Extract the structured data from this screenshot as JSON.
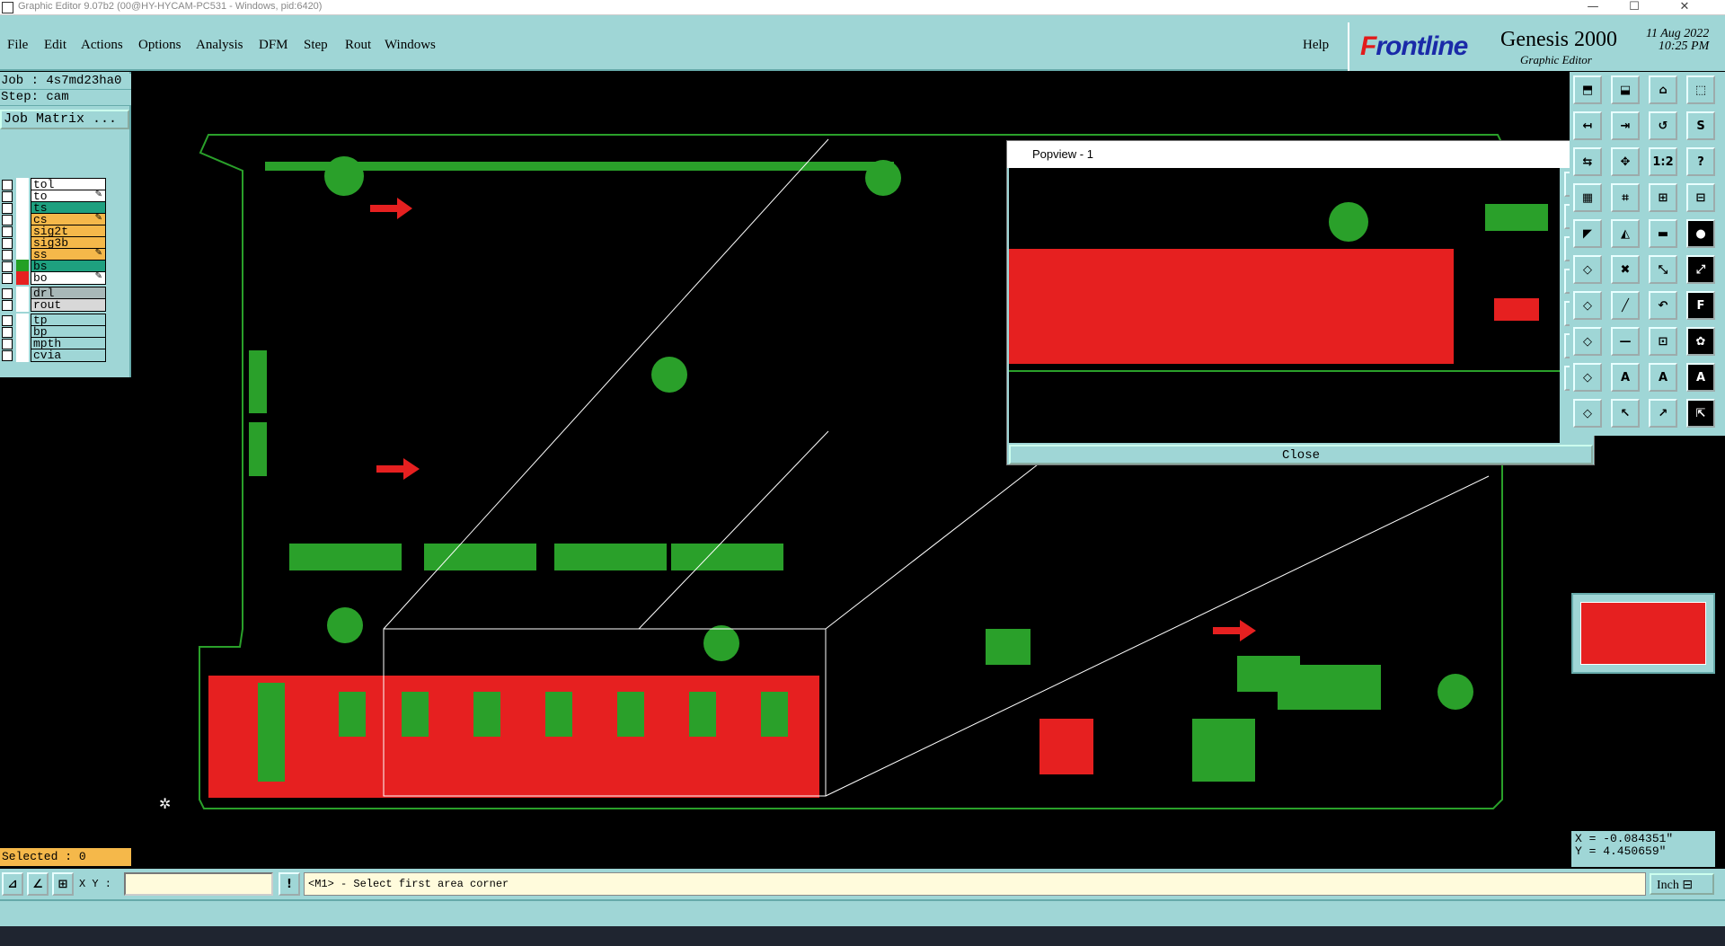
{
  "window": {
    "title": "Graphic Editor 9.07b2 (00@HY-HYCAM-PC531 - Windows, pid:6420)",
    "min": "—",
    "max": "☐",
    "close": "✕"
  },
  "menu": {
    "items": [
      "File",
      "Edit",
      "Actions",
      "Options",
      "Analysis",
      "DFM",
      "Step",
      "Rout",
      "Windows"
    ],
    "help": "Help"
  },
  "logo": {
    "brand_f": "F",
    "brand_rest": "rontline",
    "product": "Genesis 2000",
    "subtitle": "Graphic Editor",
    "date": "11 Aug 2022",
    "time": "10:25 PM"
  },
  "info": {
    "job": "Job : 4s7md23ha0",
    "step": "Step: cam",
    "job_matrix": "Job Matrix ..."
  },
  "layers": [
    {
      "name": "tol",
      "bg": "#ffffff",
      "color": "#ffffff"
    },
    {
      "name": "to",
      "bg": "#ffffff",
      "color": "#ffffff",
      "mark": "✎"
    },
    {
      "name": "ts",
      "bg": "#1ea07f",
      "color": "#ffffff"
    },
    {
      "name": "cs",
      "bg": "#f5b84a",
      "color": "#ffffff",
      "mark": "✎"
    },
    {
      "name": "sig2t",
      "bg": "#f5b84a",
      "color": "#ffffff"
    },
    {
      "name": "sig3b",
      "bg": "#f5b84a",
      "color": "#ffffff"
    },
    {
      "name": "ss",
      "bg": "#f5b84a",
      "color": "#ffffff",
      "mark": "✎"
    },
    {
      "name": "bs",
      "bg": "#1ea07f",
      "color": "#24a024"
    },
    {
      "name": "bo",
      "bg": "#ffffff",
      "color": "#e62020",
      "mark": "✎"
    },
    {
      "name": "drl",
      "bg": "#a8b8b8",
      "color": "#ffffff"
    },
    {
      "name": "rout",
      "bg": "#d8d8d8",
      "color": "#ffffff"
    },
    {
      "name": "tp",
      "bg": "#9fd6d6",
      "color": "#ffffff"
    },
    {
      "name": "bp",
      "bg": "#9fd6d6",
      "color": "#ffffff"
    },
    {
      "name": "mpth",
      "bg": "#9fd6d6",
      "color": "#ffffff"
    },
    {
      "name": "cvia",
      "bg": "#9fd6d6",
      "color": "#ffffff"
    }
  ],
  "status": {
    "selected": "Selected : 0",
    "xy_label": "X Y :",
    "xy_value": "",
    "prompt": "<M1> - Select first area corner",
    "units": "Inch ⊟"
  },
  "coords": {
    "x": "X = -0.084351\"",
    "y": "Y =  4.450659\""
  },
  "popview": {
    "title": "Popview - 1",
    "close": "Close"
  },
  "tools": [
    {
      "icon": "⬒"
    },
    {
      "icon": "⬓"
    },
    {
      "icon": "⌂"
    },
    {
      "icon": "⬚"
    },
    {
      "icon": "↤"
    },
    {
      "icon": "⇥"
    },
    {
      "icon": "↺"
    },
    {
      "icon": "S"
    },
    {
      "icon": "⇆"
    },
    {
      "icon": "✥"
    },
    {
      "icon": "1:2"
    },
    {
      "icon": "?"
    },
    {
      "icon": "▦"
    },
    {
      "icon": "⌗"
    },
    {
      "icon": "⊞"
    },
    {
      "icon": "⊟"
    },
    {
      "icon": "◤"
    },
    {
      "icon": "◭"
    },
    {
      "icon": "▬"
    },
    {
      "icon": "●"
    },
    {
      "icon": "◇"
    },
    {
      "icon": "✖"
    },
    {
      "icon": "⤡"
    },
    {
      "icon": "⤢"
    },
    {
      "icon": "◇"
    },
    {
      "icon": "╱"
    },
    {
      "icon": "↶"
    },
    {
      "icon": "F"
    },
    {
      "icon": "◇"
    },
    {
      "icon": "—"
    },
    {
      "icon": "⊡"
    },
    {
      "icon": "✿"
    },
    {
      "icon": "◇"
    },
    {
      "icon": "A"
    },
    {
      "icon": "A"
    },
    {
      "icon": "A"
    },
    {
      "icon": "◇"
    },
    {
      "icon": "↖"
    },
    {
      "icon": "↗"
    },
    {
      "icon": "⇱"
    }
  ]
}
